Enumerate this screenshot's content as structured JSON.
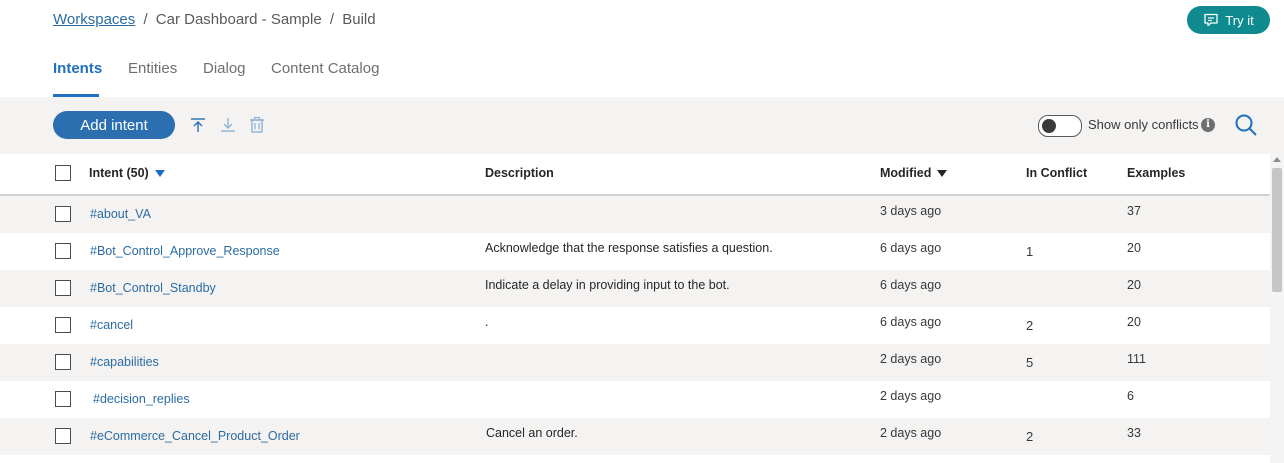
{
  "breadcrumb": {
    "root": "Workspaces",
    "path": "Car Dashboard - Sample",
    "current": "Build",
    "separator": "/"
  },
  "try_it": {
    "label": "Try it",
    "icon": "chat-icon"
  },
  "tabs": [
    {
      "label": "Intents",
      "active": true
    },
    {
      "label": "Entities",
      "active": false
    },
    {
      "label": "Dialog",
      "active": false
    },
    {
      "label": "Content Catalog",
      "active": false
    }
  ],
  "toolbar": {
    "add_label": "Add intent",
    "upload_icon": "upload-icon",
    "download_icon": "download-icon",
    "delete_icon": "trash-icon",
    "toggle_label": "Show only conflicts",
    "toggle_on": false
  },
  "table": {
    "headers": {
      "intent": "Intent (50)",
      "description": "Description",
      "modified": "Modified",
      "conflict": "In Conflict",
      "examples": "Examples"
    },
    "rows": [
      {
        "intent": "#about_VA",
        "description": "",
        "modified": "3 days ago",
        "conflict": "",
        "examples": "37"
      },
      {
        "intent": "#Bot_Control_Approve_Response",
        "description": "Acknowledge that the response satisfies a question.",
        "modified": "6 days ago",
        "conflict": "1",
        "examples": "20"
      },
      {
        "intent": "#Bot_Control_Standby",
        "description": "Indicate a delay in providing input to the bot.",
        "modified": "6 days ago",
        "conflict": "",
        "examples": "20"
      },
      {
        "intent": "#cancel",
        "description": ".",
        "modified": "6 days ago",
        "conflict": "2",
        "examples": "20"
      },
      {
        "intent": "#capabilities",
        "description": "",
        "modified": "2 days ago",
        "conflict": "5",
        "examples": "111"
      },
      {
        "intent": "#decision_replies",
        "description": "",
        "modified": "2 days ago",
        "conflict": "",
        "examples": "6"
      },
      {
        "intent": "#eCommerce_Cancel_Product_Order",
        "description": "Cancel an order.",
        "modified": "2 days ago",
        "conflict": "2",
        "examples": "33"
      }
    ]
  },
  "colors": {
    "accent": "#1f70c1",
    "try_it": "#0f8a8e",
    "link": "#2b6ca3",
    "row_alt": "#f4f3f2"
  }
}
